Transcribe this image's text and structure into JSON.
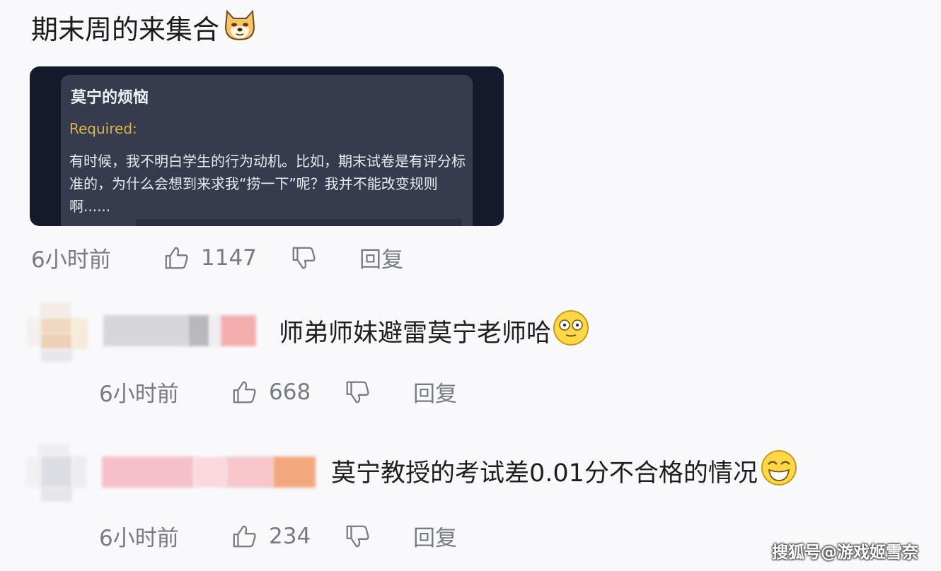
{
  "post": {
    "title": "期末周的来集合",
    "title_emoji": "doge-emoji",
    "card": {
      "title": "莫宁的烦恼",
      "required_label": "Required:",
      "body": "有时候，我不明白学生的行为动机。比如，期末试卷是有评分标准的，为什么会想到来求我“捞一下”呢？我并不能改变规则啊......"
    },
    "time": "6小时前",
    "likes": "1147",
    "reply_label": "回复"
  },
  "replies": [
    {
      "text": "师弟师妹避雷莫宁老师哈",
      "emoji": "dazed-face-emoji",
      "time": "6小时前",
      "likes": "668",
      "reply_label": "回复"
    },
    {
      "text": "莫宁教授的考试差0.01分不合格的情况",
      "emoji": "grinning-squint-emoji",
      "time": "6小时前",
      "likes": "234",
      "reply_label": "回复"
    }
  ],
  "watermark": "搜狐号@游戏姬雪奈",
  "colors": {
    "background": "#f9f9fb",
    "card_background": "#141a2b",
    "required_label": "#d9b356",
    "meta_text": "#777b82"
  }
}
